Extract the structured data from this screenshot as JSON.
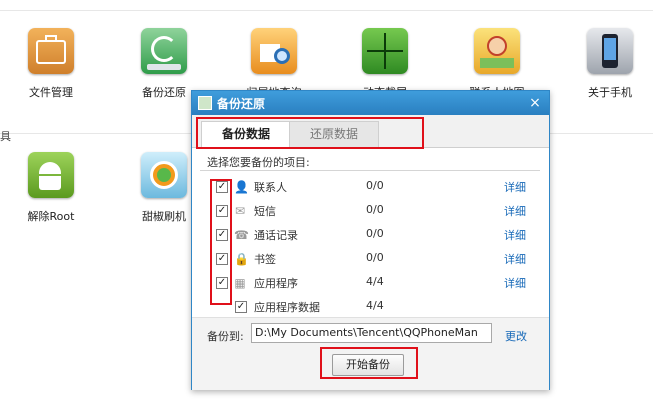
{
  "tools": [
    {
      "label": "文件管理",
      "icon": "briefcase-icon",
      "color": "#d78b34"
    },
    {
      "label": "备份还原",
      "icon": "backup-restore-icon",
      "color": "#3fae5a"
    },
    {
      "label": "归属地查询",
      "icon": "house-search-icon",
      "color": "#f0a038"
    },
    {
      "label": "动态截屏",
      "icon": "screenshot-crosshair-icon",
      "color": "#3b9a2e"
    },
    {
      "label": "联系人地图",
      "icon": "contact-map-icon",
      "color": "#f1c232"
    },
    {
      "label": "关于手机",
      "icon": "phone-icon",
      "color": "#555b66"
    },
    {
      "label": "解除Root",
      "icon": "android-icon",
      "color": "#78b62f"
    },
    {
      "label": "甜椒刷机",
      "icon": "flash-icon",
      "color": "#4aa9d8"
    }
  ],
  "section_label": "具",
  "dialog": {
    "title": "备份还原",
    "close_glyph": "×",
    "tabs": [
      {
        "label": "备份数据",
        "active": true
      },
      {
        "label": "还原数据",
        "active": false
      }
    ],
    "prompt": "选择您要备份的项目:",
    "items": [
      {
        "name": "联系人",
        "count": "0/0",
        "detail": "详细",
        "checked": true,
        "icon": "contact-icon"
      },
      {
        "name": "短信",
        "count": "0/0",
        "detail": "详细",
        "checked": true,
        "icon": "sms-icon"
      },
      {
        "name": "通话记录",
        "count": "0/0",
        "detail": "详细",
        "checked": true,
        "icon": "call-log-icon"
      },
      {
        "name": "书签",
        "count": "0/0",
        "detail": "详细",
        "checked": true,
        "icon": "bookmark-icon"
      },
      {
        "name": "应用程序",
        "count": "4/4",
        "detail": "详细",
        "checked": true,
        "icon": "apps-icon"
      },
      {
        "name": "应用程序数据",
        "count": "4/4",
        "detail": "",
        "checked": true,
        "icon": ""
      }
    ],
    "backup_to_label": "备份到:",
    "backup_path": "D:\\My Documents\\Tencent\\QQPhoneMan",
    "change_link": "更改",
    "start_button": "开始备份",
    "highlight_color": "#e0101a"
  }
}
